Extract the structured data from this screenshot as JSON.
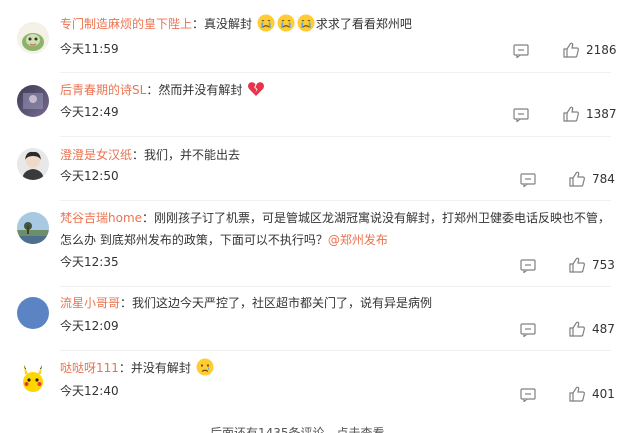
{
  "comments": [
    {
      "username": "专门制造麻烦的皇下陛上",
      "separator": "：",
      "text": "真没解封",
      "text_after_emojis": "求求了看看郑州吧",
      "emojis": [
        "crying-face",
        "crying-face",
        "crying-face"
      ],
      "time": "今天11:59",
      "likes": "2186"
    },
    {
      "username": "后青春期的诗SL",
      "separator": "：",
      "text": "然而并没有解封",
      "emojis": [
        "broken-heart"
      ],
      "time": "今天12:49",
      "likes": "1387"
    },
    {
      "username": "澄澄是女汉纸",
      "separator": "：",
      "text": "我们，并不能出去",
      "time": "今天12:50",
      "likes": "784"
    },
    {
      "username": "梵谷吉瑞home",
      "separator": "：",
      "text": "刚刚孩子订了机票，可是管城区龙湖冠寓说没有解封，打郑州卫健委电话反映也不管，",
      "text_line2": "怎么办 到底郑州发布的政策，下面可以不执行吗？",
      "mention": "@郑州发布",
      "time": "今天12:35",
      "likes": "753"
    },
    {
      "username": "流星小哥哥",
      "separator": "：",
      "text": "我们这边今天严控了，社区超市都关门了，说有异是病例",
      "time": "今天12:09",
      "likes": "487"
    },
    {
      "username": "哒哒呀111",
      "separator": "：",
      "text": "并没有解封",
      "emojis": [
        "sad-face"
      ],
      "time": "今天12:40",
      "likes": "401"
    }
  ],
  "footer": {
    "more_text": "后面还有1435条评论，点击查看"
  },
  "colors": {
    "username": "#eb7350",
    "text": "#333333",
    "icon": "#808080",
    "divider": "#f0f0f0"
  }
}
